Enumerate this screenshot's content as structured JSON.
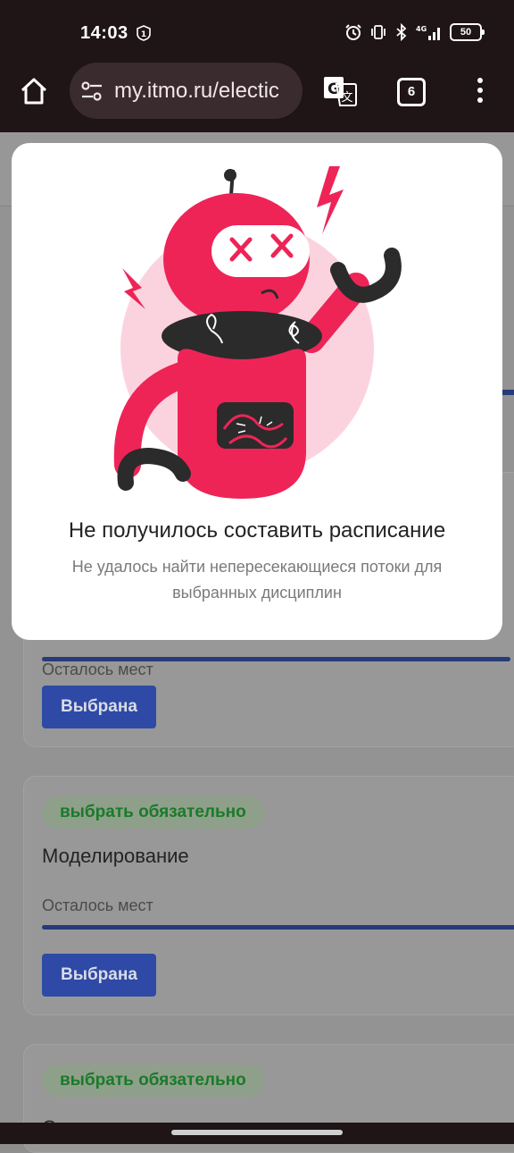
{
  "status_bar": {
    "time": "14:03",
    "sim_badge": "1",
    "network": "4G",
    "battery": "50"
  },
  "browser": {
    "url": "my.itmo.ru/electic",
    "tab_count": "6",
    "icons": [
      "home-icon",
      "tune-icon",
      "translate-icon",
      "tabs-icon",
      "more-vert-icon"
    ]
  },
  "page": {
    "cards": [
      {
        "badge": "",
        "title": "",
        "seats_label": "Осталось мест",
        "button": "Выбрана"
      },
      {
        "badge": "выбрать обязательно",
        "title": "Моделирование",
        "seats_label": "Осталось мест",
        "button": "Выбрана"
      },
      {
        "badge": "выбрать обязательно",
        "title": "Системы искусственного интеллекта",
        "seats_label": "",
        "button": ""
      }
    ]
  },
  "modal": {
    "title": "Не получилось составить расписание",
    "message": "Не удалось найти непересекающиеся потоки для выбранных дисциплин",
    "illustration": "broken-robot-illustration"
  },
  "colors": {
    "accent": "#ee2457",
    "badge_text": "#2e9a3a",
    "button": "#3558c9",
    "dark": "#2b2b2b"
  }
}
